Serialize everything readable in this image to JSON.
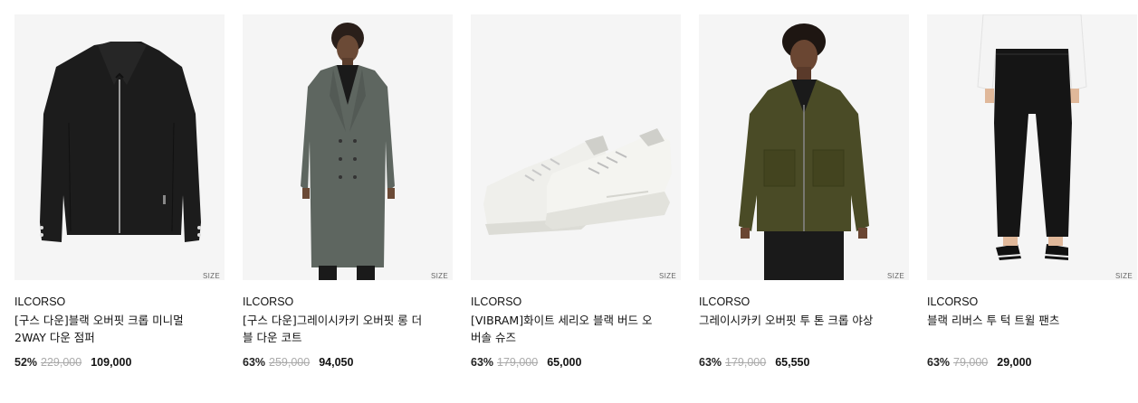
{
  "products": [
    {
      "brand": "ILCORSO",
      "name": "[구스 다운]블랙 오버핏 크롭 미니멀 2WAY 다운 점퍼",
      "discount": "52%",
      "original_price": "229,000",
      "sale_price": "109,000",
      "size_label": "SIZE",
      "image": "black-down-jacket"
    },
    {
      "brand": "ILCORSO",
      "name": "[구스 다운]그레이시카키 오버핏 롱 더블 다운 코트",
      "discount": "63%",
      "original_price": "259,000",
      "sale_price": "94,050",
      "size_label": "SIZE",
      "image": "grayish-khaki-long-coat"
    },
    {
      "brand": "ILCORSO",
      "name": "[VIBRAM]화이트 세리오 블랙 버드 오버솔 슈즈",
      "discount": "63%",
      "original_price": "179,000",
      "sale_price": "65,000",
      "size_label": "SIZE",
      "image": "white-sneakers"
    },
    {
      "brand": "ILCORSO",
      "name": "그레이시카키 오버핏 투 톤 크롭 야상",
      "discount": "63%",
      "original_price": "179,000",
      "sale_price": "65,550",
      "size_label": "SIZE",
      "image": "khaki-field-jacket"
    },
    {
      "brand": "ILCORSO",
      "name": "블랙 리버스 투 턱 트윌 팬츠",
      "discount": "63%",
      "original_price": "79,000",
      "sale_price": "29,000",
      "size_label": "SIZE",
      "image": "black-tuck-pants"
    }
  ]
}
